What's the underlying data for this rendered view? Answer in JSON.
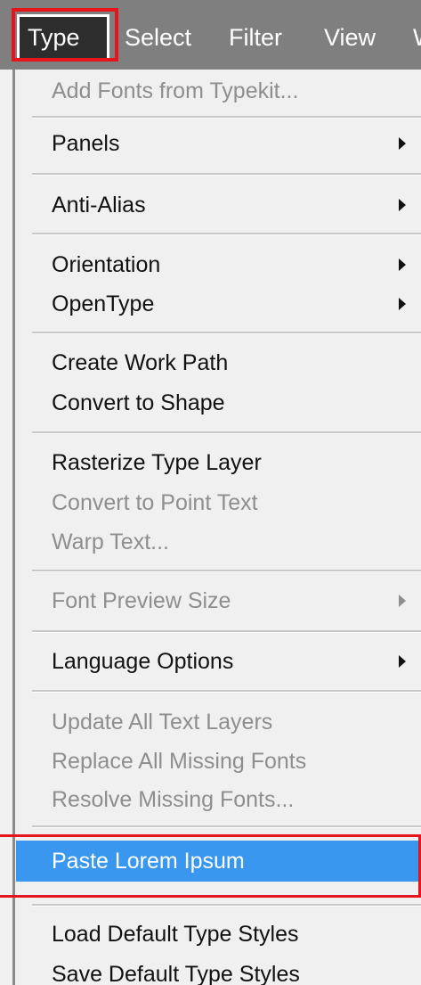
{
  "menubar": {
    "items": [
      "Type",
      "Select",
      "Filter",
      "View",
      "W"
    ]
  },
  "menu": {
    "items": [
      {
        "label": "Add Fonts from Typekit...",
        "enabled": false,
        "submenu": false
      },
      {
        "label": "Panels",
        "enabled": true,
        "submenu": true
      },
      {
        "label": "Anti-Alias",
        "enabled": true,
        "submenu": true
      },
      {
        "label": "Orientation",
        "enabled": true,
        "submenu": true
      },
      {
        "label": "OpenType",
        "enabled": true,
        "submenu": true
      },
      {
        "label": "Create Work Path",
        "enabled": true,
        "submenu": false
      },
      {
        "label": "Convert to Shape",
        "enabled": true,
        "submenu": false
      },
      {
        "label": "Rasterize Type Layer",
        "enabled": true,
        "submenu": false
      },
      {
        "label": "Convert to Point Text",
        "enabled": false,
        "submenu": false
      },
      {
        "label": "Warp Text...",
        "enabled": false,
        "submenu": false
      },
      {
        "label": "Font Preview Size",
        "enabled": false,
        "submenu": true
      },
      {
        "label": "Language Options",
        "enabled": true,
        "submenu": true
      },
      {
        "label": "Update All Text Layers",
        "enabled": false,
        "submenu": false
      },
      {
        "label": "Replace All Missing Fonts",
        "enabled": false,
        "submenu": false
      },
      {
        "label": "Resolve Missing Fonts...",
        "enabled": false,
        "submenu": false
      },
      {
        "label": "Paste Lorem Ipsum",
        "enabled": true,
        "submenu": false,
        "selected": true
      },
      {
        "label": "Load Default Type Styles",
        "enabled": true,
        "submenu": false
      },
      {
        "label": "Save Default Type Styles",
        "enabled": true,
        "submenu": false
      }
    ]
  },
  "colors": {
    "selection": "#3a97ef",
    "annotation": "#e8141c",
    "menubar": "#7f7f7f"
  }
}
